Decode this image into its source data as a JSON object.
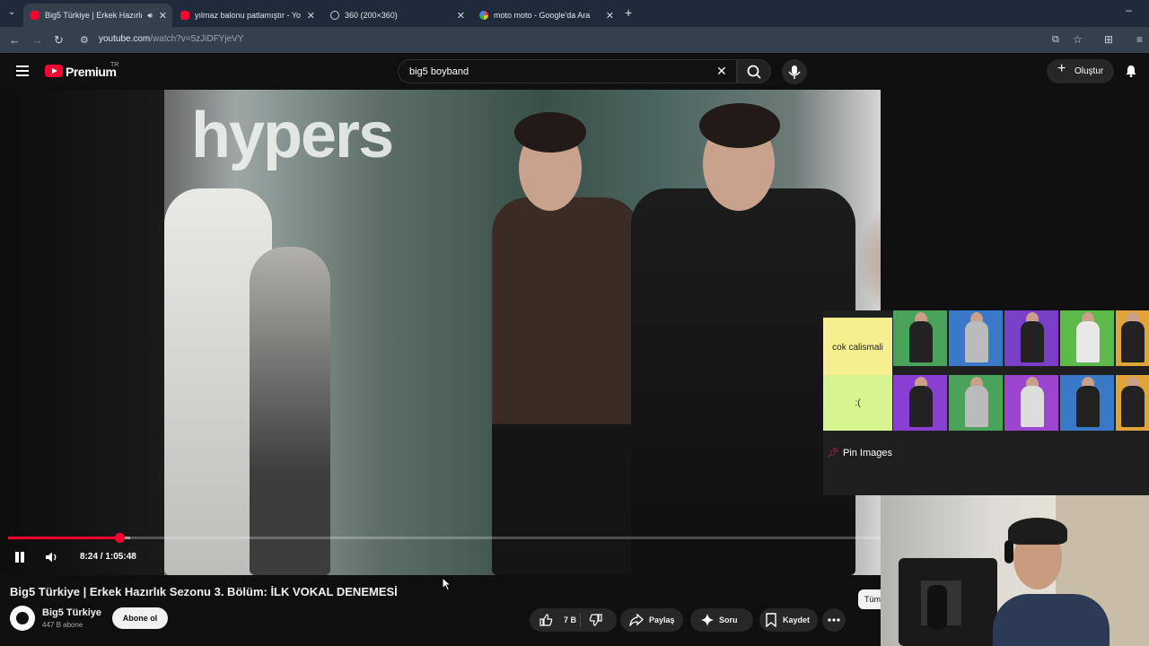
{
  "browser": {
    "tabs": [
      {
        "title": "Big5 Türkiye | Erkek Hazırlık",
        "icon": "youtube-icon",
        "active": true,
        "playing_audio": true
      },
      {
        "title": "yılmaz balonu patlamıştır - You",
        "icon": "youtube-icon",
        "active": false
      },
      {
        "title": "360 (200×360)",
        "icon": "globe-icon",
        "active": false
      },
      {
        "title": "moto moto - Google'da Ara",
        "icon": "google-icon",
        "active": false
      }
    ],
    "new_tab_label": "+",
    "url_host": "youtube.com",
    "url_path": "/watch?v=5zJiDFYjeVY"
  },
  "header": {
    "logo_text": "Premium",
    "logo_region": "TR",
    "search_value": "big5 boyband",
    "create_label": "Oluştur"
  },
  "video": {
    "overlay_text": "hypers",
    "current_time": "8:24",
    "duration": "1:05:48",
    "time_display": "8:24 / 1:05:48",
    "progress_fraction": 0.128,
    "buffer_fraction": 0.14,
    "title": "Big5 Türkiye | Erkek Hazırlık Sezonu 3. Bölüm: İLK VOKAL DENEMESİ"
  },
  "channel": {
    "name": "Big5 Türkiye",
    "subscribers": "447 B abone",
    "subscribe_label": "Abone ol"
  },
  "actions": {
    "like_count": "7 B",
    "share_label": "Paylaş",
    "ask_label": "Soru",
    "save_label": "Kaydet"
  },
  "chips": {
    "all_label": "Tüm"
  },
  "overlay": {
    "tiers": [
      {
        "label": "cok calismali",
        "color": "#f5f08d"
      },
      {
        "label": ":(",
        "color": "#d6f590"
      }
    ],
    "pin_label": "Pin Images"
  },
  "colors": {
    "accent_red": "#ff0033",
    "background": "#0f0f0f",
    "chrome": "#35404d"
  }
}
